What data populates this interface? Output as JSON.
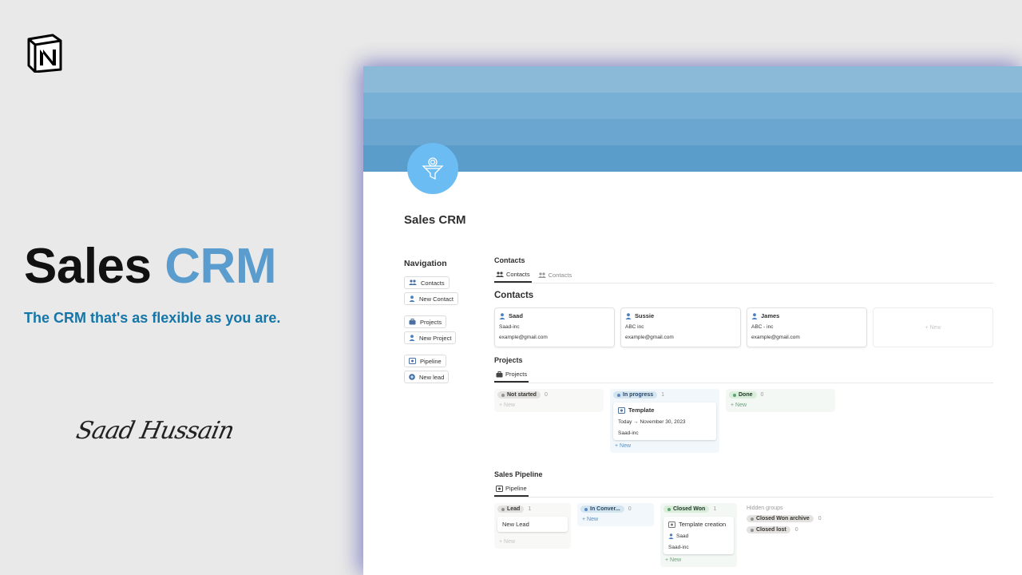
{
  "promo": {
    "title_main": "Sales",
    "title_accent": "CRM",
    "subtitle": "The CRM that's as flexible as you are.",
    "signature": "Saad Hussain"
  },
  "page": {
    "title": "Sales CRM",
    "icon": "funnel-icon"
  },
  "colors": {
    "cover_bands": [
      "#8bbad9",
      "#78afd4",
      "#6aa6d0",
      "#5a9dcb"
    ],
    "icon_bg": "#6bbcf3",
    "accent": "#5a9ccd",
    "subtitle": "#1476a8"
  },
  "navigation": {
    "title": "Navigation",
    "groups": [
      [
        {
          "label": "Contacts",
          "icon": "people-icon"
        },
        {
          "label": "New Contact",
          "icon": "person-icon"
        }
      ],
      [
        {
          "label": "Projects",
          "icon": "briefcase-icon"
        },
        {
          "label": "New Project",
          "icon": "person-icon"
        }
      ],
      [
        {
          "label": "Pipeline",
          "icon": "pipeline-icon"
        },
        {
          "label": "New lead",
          "icon": "plus-circle-icon"
        }
      ]
    ]
  },
  "contacts": {
    "section_title": "Contacts",
    "tabs": [
      "Contacts",
      "Contacts"
    ],
    "db_title": "Contacts",
    "cards": [
      {
        "name": "Saad",
        "company": "Saad-inc",
        "email": "example@gmail.com"
      },
      {
        "name": "Sussie",
        "company": "ABC inc",
        "email": "example@gmail.com"
      },
      {
        "name": "James",
        "company": "ABC - inc",
        "email": "example@gmail.com"
      }
    ],
    "add_label": "+ New"
  },
  "projects": {
    "section_title": "Projects",
    "tab": "Projects",
    "columns": [
      {
        "status": "Not started",
        "count": "0",
        "new_label": "+ New"
      },
      {
        "status": "In progress",
        "count": "1",
        "new_label": "+ New",
        "card": {
          "title": "Template",
          "dates": "Today → November 30, 2023",
          "company": "Saad-inc"
        }
      },
      {
        "status": "Done",
        "count": "0",
        "new_label": "+ New"
      }
    ]
  },
  "pipeline": {
    "section_title": "Sales Pipeline",
    "tab": "Pipeline",
    "columns": [
      {
        "status": "Lead",
        "count": "1",
        "new_label": "+ New",
        "card": {
          "title": "New Lead"
        }
      },
      {
        "status": "In Conver...",
        "count": "0",
        "new_label": "+ New"
      },
      {
        "status": "Closed Won",
        "count": "1",
        "new_label": "+ New",
        "card": {
          "title": "Template creation",
          "person": "Saad",
          "company": "Saad-inc"
        }
      }
    ],
    "hidden": {
      "title": "Hidden groups",
      "groups": [
        {
          "status": "Closed Won archive",
          "count": "0"
        },
        {
          "status": "Closed lost",
          "count": "0"
        }
      ]
    }
  }
}
